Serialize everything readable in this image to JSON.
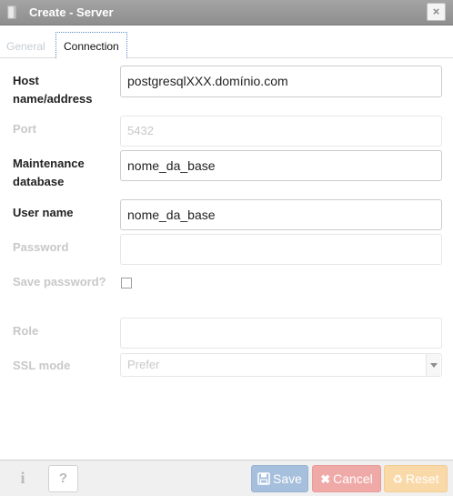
{
  "window": {
    "title": "Create - Server",
    "close_glyph": "×",
    "icon": "server-icon"
  },
  "tabs": [
    {
      "label": "General",
      "active": false
    },
    {
      "label": "Connection",
      "active": true
    }
  ],
  "form": {
    "host": {
      "label": "Host name/address",
      "value": "postgresqlXXX.domínio.com"
    },
    "port": {
      "label": "Port",
      "value": "5432"
    },
    "maintenance_db": {
      "label": "Maintenance database",
      "value": "nome_da_base"
    },
    "username": {
      "label": "User name",
      "value": "nome_da_base"
    },
    "password": {
      "label": "Password",
      "value": ""
    },
    "save_password": {
      "label": "Save password?",
      "checked": false
    },
    "role": {
      "label": "Role",
      "value": ""
    },
    "ssl_mode": {
      "label": "SSL mode",
      "value": "Prefer"
    }
  },
  "footer": {
    "info_glyph": "i",
    "help_glyph": "?",
    "save_label": "Save",
    "cancel_label": "Cancel",
    "reset_label": "Reset"
  },
  "colors": {
    "titlebar": "#9a9a9a",
    "save": "#a6bfdc",
    "cancel": "#efaaa8",
    "reset": "#fad9a8"
  }
}
